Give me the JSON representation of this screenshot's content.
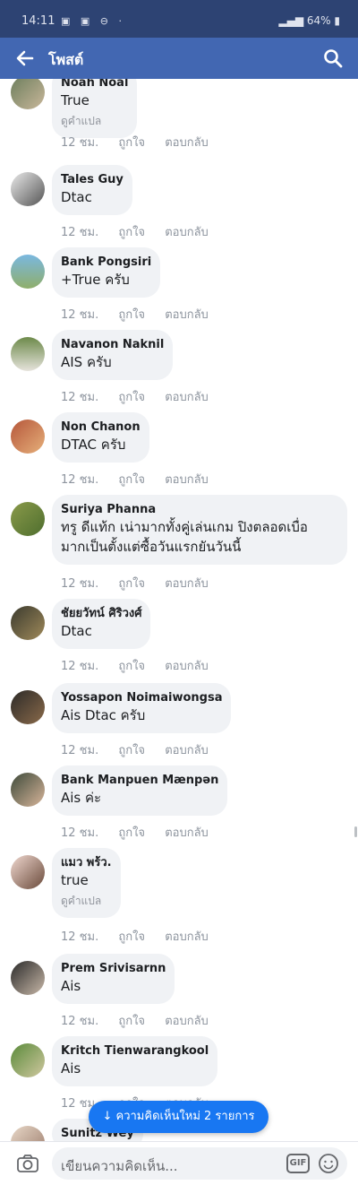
{
  "status_bar": {
    "time": "14:11",
    "battery": "64%"
  },
  "header": {
    "title": "โพสต์"
  },
  "comments": [
    {
      "name": "Noah Noal",
      "text": "True",
      "translate": "ดูคำแปล",
      "time": "12 ชม.",
      "like": "ถูกใจ",
      "reply": "ตอบกลับ"
    },
    {
      "name": "Tales Guy",
      "text": "Dtac",
      "time": "12 ชม.",
      "like": "ถูกใจ",
      "reply": "ตอบกลับ"
    },
    {
      "name": "Bank Pongsiri",
      "text": "+True ครับ",
      "time": "12 ชม.",
      "like": "ถูกใจ",
      "reply": "ตอบกลับ"
    },
    {
      "name": "Navanon Naknil",
      "text": "AIS ครับ",
      "time": "12 ชม.",
      "like": "ถูกใจ",
      "reply": "ตอบกลับ"
    },
    {
      "name": "Non Chanon",
      "text": "DTAC ครับ",
      "time": "12 ชม.",
      "like": "ถูกใจ",
      "reply": "ตอบกลับ"
    },
    {
      "name": "Suriya Phanna",
      "text_line1": "ทรู ดีแท้ก เน่ามากทั้งคู่เล่นเกม ปิงตลอดเบื่อ",
      "text_line2": "มากเป็นตั้งแต่ซื้อวันแรกยันวันนี้",
      "time": "12 ชม.",
      "like": "ถูกใจ",
      "reply": "ตอบกลับ"
    },
    {
      "name": "ชัยยวัทน์ ศิริวงศ์",
      "text": "Dtac",
      "time": "12 ชม.",
      "like": "ถูกใจ",
      "reply": "ตอบกลับ"
    },
    {
      "name": "Yossapon Noimaiwongsa",
      "text": "Ais Dtac ครับ",
      "time": "12 ชม.",
      "like": "ถูกใจ",
      "reply": "ตอบกลับ"
    },
    {
      "name": "Bank Manpuen Mænpən",
      "text": "Ais ค่ะ",
      "time": "12 ชม.",
      "like": "ถูกใจ",
      "reply": "ตอบกลับ"
    },
    {
      "name": "แมว พร้ว.",
      "text": "true",
      "translate": "ดูคำแปล",
      "time": "12 ชม.",
      "like": "ถูกใจ",
      "reply": "ตอบกลับ"
    },
    {
      "name": "Prem Srivisarnn",
      "text": "Ais",
      "time": "12 ชม.",
      "like": "ถูกใจ",
      "reply": "ตอบกลับ"
    },
    {
      "name": "Kritch Tienwarangkool",
      "text": "Ais",
      "time": "12 ชม.",
      "like": "ถูกใจ",
      "reply": "ตอบกลับ"
    },
    {
      "name": "Sunitz Wey"
    }
  ],
  "new_comments_pill": "↓ ความคิดเห็นใหม่ 2 รายการ",
  "composer": {
    "placeholder": "เขียนความคิดเห็น...",
    "gif_label": "GIF"
  },
  "colors": {
    "statusbar": "#2d4373",
    "appbar": "#4267b2",
    "bubble": "#f0f2f5",
    "pill": "#1877f2",
    "meta_text": "#8d949e"
  }
}
